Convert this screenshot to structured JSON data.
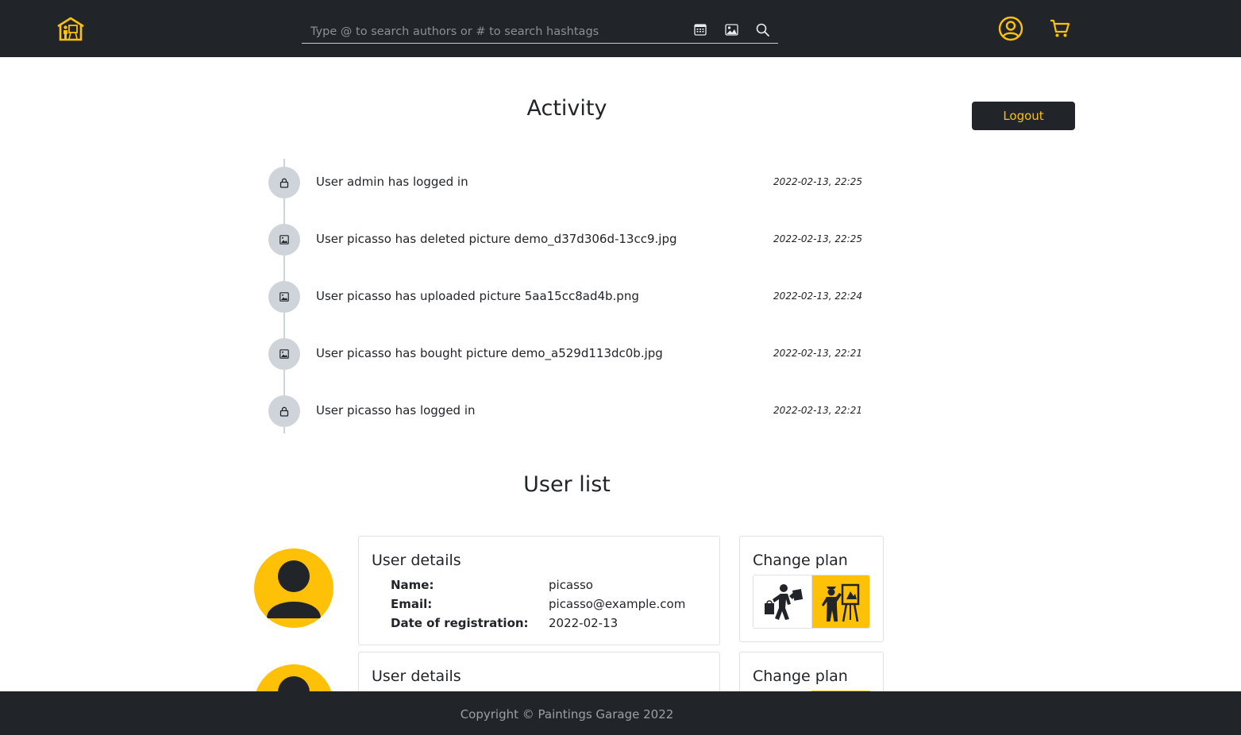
{
  "header": {
    "logo_icon": "paintings-garage-house-icon",
    "search": {
      "placeholder": "Type @ to search authors or # to search hashtags",
      "value": "",
      "icons": [
        "calendar-icon",
        "image-icon",
        "search-icon"
      ]
    },
    "icons": [
      "user-circle-icon",
      "cart-icon"
    ],
    "accent_color": "#ffc107",
    "bg_color": "#212529"
  },
  "activity": {
    "title": "Activity",
    "logout_label": "Logout",
    "items": [
      {
        "icon": "lock-icon",
        "text": "User admin has logged in",
        "time": "2022-02-13, 22:25"
      },
      {
        "icon": "image-icon",
        "text": "User picasso has deleted picture demo_d37d306d-13cc9.jpg",
        "time": "2022-02-13, 22:25"
      },
      {
        "icon": "image-icon",
        "text": "User picasso has uploaded picture 5aa15cc8ad4b.png",
        "time": "2022-02-13, 22:24"
      },
      {
        "icon": "image-icon",
        "text": "User picasso has bought picture demo_a529d113dc0b.jpg",
        "time": "2022-02-13, 22:21"
      },
      {
        "icon": "lock-icon",
        "text": "User picasso has logged in",
        "time": "2022-02-13, 22:21"
      }
    ]
  },
  "user_list": {
    "title": "User list",
    "users": [
      {
        "details_title": "User details",
        "name_label": "Name:",
        "name": "picasso",
        "email_label": "Email:",
        "email": "picasso@example.com",
        "date_label": "Date of registration:",
        "date": "2022-02-13",
        "plan_title": "Change plan",
        "plan_options": [
          "buyer-icon",
          "painter-icon"
        ],
        "active_plan": "painter-icon"
      },
      {
        "details_title": "User details",
        "plan_title": "Change plan"
      }
    ]
  },
  "footer": {
    "text": "Copyright © Paintings Garage 2022"
  }
}
